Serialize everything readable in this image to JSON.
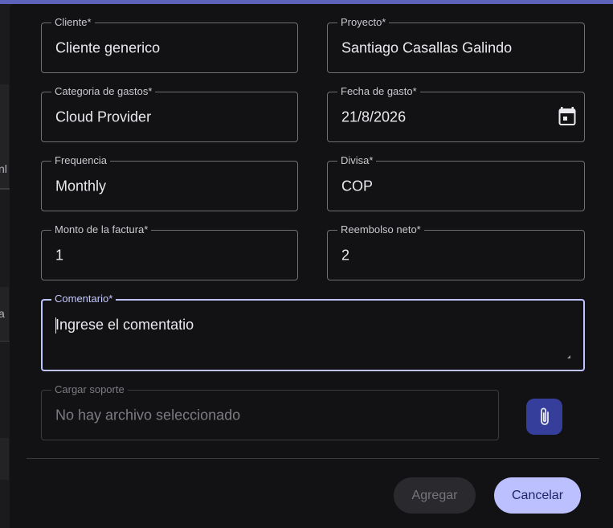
{
  "backdrop": {
    "text_1": "nl",
    "text_2": "a"
  },
  "form": {
    "cliente": {
      "label": "Cliente*",
      "value": "Cliente generico"
    },
    "proyecto": {
      "label": "Proyecto*",
      "value": "Santiago Casallas Galindo"
    },
    "categoria": {
      "label": "Categoria de gastos*",
      "value": "Cloud Provider"
    },
    "fecha": {
      "label": "Fecha de gasto*",
      "value": "21/8/2026"
    },
    "frecuencia": {
      "label": "Frequencia",
      "value": "Monthly"
    },
    "divisa": {
      "label": "Divisa*",
      "value": "COP"
    },
    "monto": {
      "label": "Monto de la factura*",
      "value": "1"
    },
    "reembolso": {
      "label": "Reembolso neto*",
      "value": "2"
    },
    "comentario": {
      "label": "Comentario*",
      "value": "Ingrese el comentatio"
    },
    "soporte": {
      "label": "Cargar soporte",
      "value": "No hay archivo seleccionado"
    }
  },
  "actions": {
    "agregar_label": "Agregar",
    "cancelar_label": "Cancelar"
  },
  "icons": {
    "date": "calendar-icon",
    "attach": "paperclip-icon"
  },
  "colors": {
    "accent": "#bcc0ff",
    "attach_button": "#363e9c",
    "top_bar": "#5c63b8"
  }
}
